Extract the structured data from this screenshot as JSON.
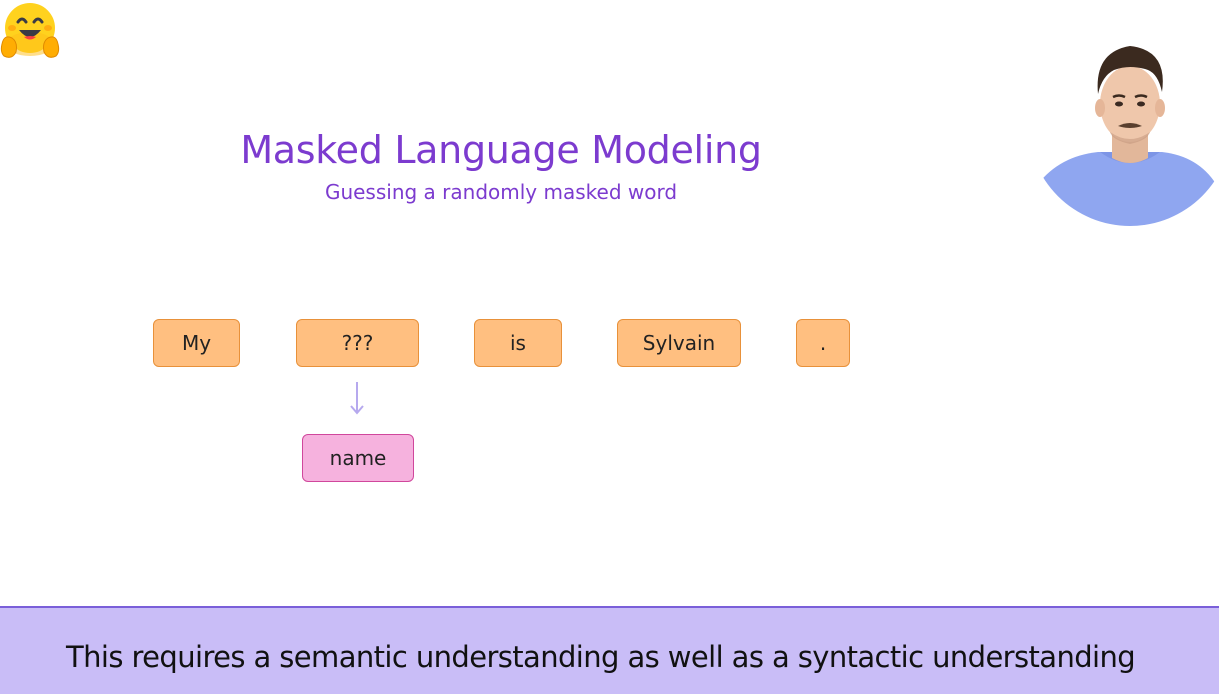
{
  "slide": {
    "title": "Masked Language Modeling",
    "subtitle": "Guessing a randomly masked word",
    "tokens": [
      "My",
      "???",
      "is",
      "Sylvain",
      "."
    ],
    "prediction": "name"
  },
  "caption": {
    "text": "This requires a semantic understanding as well as a syntactic understanding"
  },
  "icons": {
    "logo": "hugging-face-emoji",
    "arrow": "arrow-down-icon"
  },
  "colors": {
    "title": "#7c3bcf",
    "token_fill": "#ffbf80",
    "token_border": "#e8913a",
    "prediction_fill": "#f6b2de",
    "prediction_border": "#d0479c",
    "caption_bg": "#c9bdf7"
  }
}
